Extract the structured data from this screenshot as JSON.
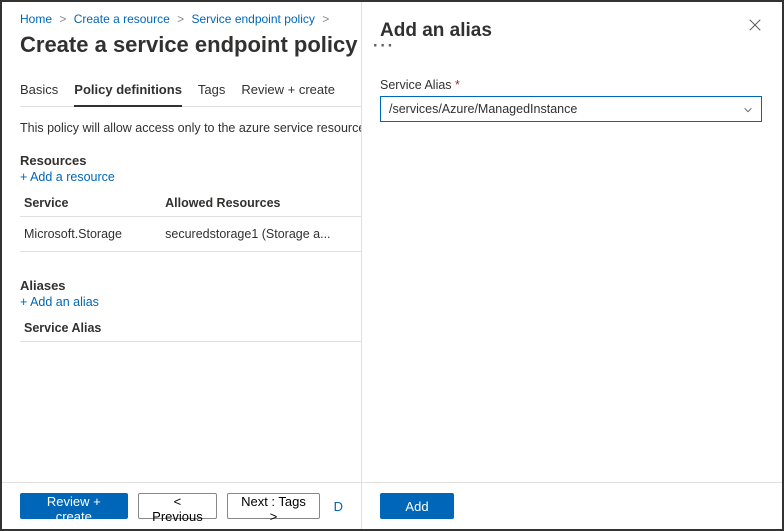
{
  "breadcrumb": {
    "home": "Home",
    "create_resource": "Create a resource",
    "service_endpoint_policy": "Service endpoint policy"
  },
  "page_title": "Create a service endpoint policy",
  "tabs": {
    "basics": "Basics",
    "policy_definitions": "Policy definitions",
    "tags": "Tags",
    "review_create": "Review + create"
  },
  "description": "This policy will allow access only to the azure service resources list",
  "resources": {
    "heading": "Resources",
    "add_link": "Add a resource",
    "columns": {
      "service": "Service",
      "allowed": "Allowed Resources"
    },
    "rows": [
      {
        "service": "Microsoft.Storage",
        "allowed": "securedstorage1 (Storage a..."
      }
    ]
  },
  "aliases": {
    "heading": "Aliases",
    "add_link": "Add an alias",
    "columns": {
      "service_alias": "Service Alias"
    }
  },
  "footer": {
    "review_create": "Review + create",
    "previous": "< Previous",
    "next": "Next : Tags >",
    "discard_stub": "D"
  },
  "panel": {
    "title": "Add an alias",
    "field_label": "Service Alias",
    "selected_value": "/services/Azure/ManagedInstance",
    "add_button": "Add"
  }
}
